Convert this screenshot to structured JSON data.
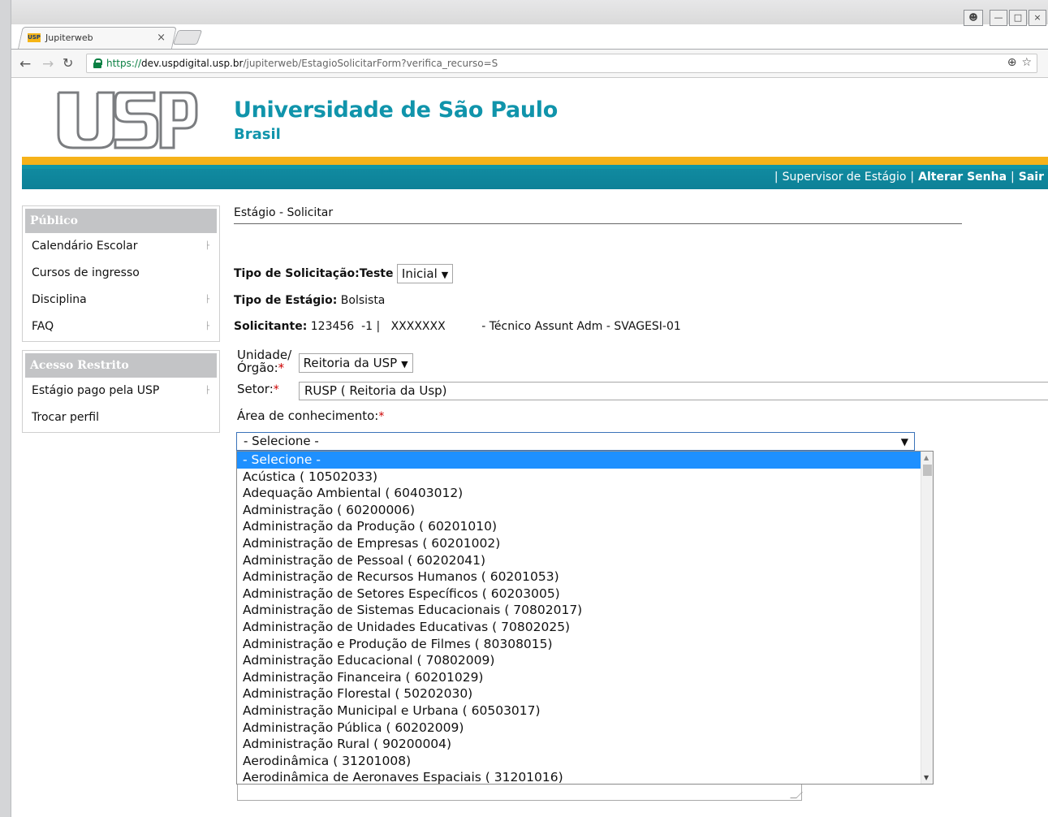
{
  "browser": {
    "tab_title": "Jupiterweb",
    "tab_close": "×",
    "favicon_text": "USP",
    "url_scheme": "https://",
    "url_host": "dev.uspdigital.usp.br",
    "url_path": "/jupiterweb/EstagioSolicitarForm?verifica_recurso=S",
    "secure_color": "#0b8043"
  },
  "header": {
    "title": "Universidade de São Paulo",
    "subtitle": "Brasil",
    "brand_color": "#1094ab",
    "accent_yellow": "#f6b21a",
    "accent_teal": "#108aa0"
  },
  "topmenu": {
    "supervisor": "Supervisor de Estágio",
    "alterar_senha": "Alterar Senha",
    "sair": "Sair"
  },
  "sidebar": {
    "publico": {
      "title": "Público",
      "items": [
        {
          "label": "Calendário Escolar",
          "submenu": true
        },
        {
          "label": "Cursos de ingresso",
          "submenu": false
        },
        {
          "label": "Disciplina",
          "submenu": true
        },
        {
          "label": "FAQ",
          "submenu": true
        }
      ]
    },
    "restrito": {
      "title": "Acesso Restrito",
      "items": [
        {
          "label": "Estágio pago pela USP",
          "submenu": true
        },
        {
          "label": "Trocar perfil",
          "submenu": false
        }
      ]
    }
  },
  "content": {
    "breadcrumb": "Estágio - Solicitar",
    "tipo_solicitacao_label": "Tipo de Solicitação:Teste",
    "tipo_solicitacao_value": "Inicial",
    "tipo_estagio_label": "Tipo de Estágio:",
    "tipo_estagio_value": "Bolsista",
    "solicitante_label": "Solicitante:",
    "solicitante_value": "123456  -1 |   XXXXXXX          - Técnico Assunt Adm - SVAGESI-01",
    "unidade_label_1": "Unidade/",
    "unidade_label_2": "Órgão:",
    "unidade_value": "Reitoria da USP",
    "setor_label": "Setor:",
    "setor_value": "RUSP ( Reitoria da Usp)",
    "area_label": "Área de conhecimento:",
    "area_selected": "- Selecione -",
    "required_mark": "*",
    "area_options": [
      "- Selecione -",
      "Acústica ( 10502033)",
      "Adequação Ambiental ( 60403012)",
      "Administração ( 60200006)",
      "Administração da Produção ( 60201010)",
      "Administração de Empresas ( 60201002)",
      "Administração de Pessoal ( 60202041)",
      "Administração de Recursos Humanos ( 60201053)",
      "Administração de Setores Específicos ( 60203005)",
      "Administração de Sistemas Educacionais ( 70802017)",
      "Administração de Unidades Educativas ( 70802025)",
      "Administração e Produção de Filmes ( 80308015)",
      "Administração Educacional ( 70802009)",
      "Administração Financeira ( 60201029)",
      "Administração Florestal ( 50202030)",
      "Administração Municipal e Urbana ( 60503017)",
      "Administração Pública ( 60202009)",
      "Administração Rural ( 90200004)",
      "Aerodinâmica ( 31201008)",
      "Aerodinâmica de Aeronaves Espaciais ( 31201016)"
    ],
    "selection_color": "#1e90ff"
  }
}
